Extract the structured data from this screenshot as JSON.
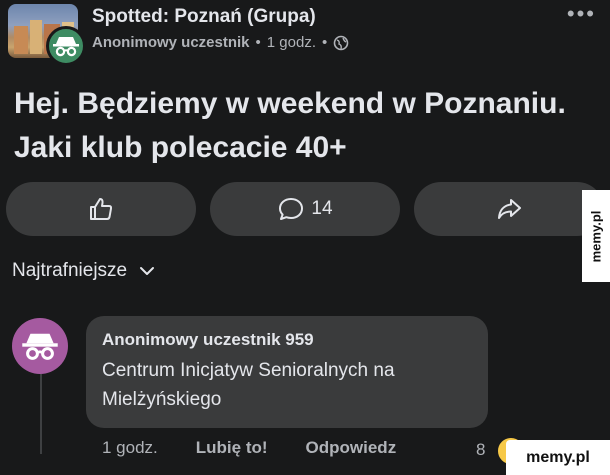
{
  "post": {
    "group_name": "Spotted: Poznań (Grupa)",
    "author": "Anonimowy uczestnik",
    "separator": "•",
    "time": "1 godz.",
    "separator2": "•",
    "text": "Hej. Będziemy w weekend w Poznaniu. Jaki klub polecacie 40+",
    "more_label": "•••"
  },
  "actions": {
    "like_icon": "thumbs-up-icon",
    "comment_icon": "comment-icon",
    "comment_count": "14",
    "share_icon": "share-icon"
  },
  "sort": {
    "label": "Najtrafniejsze"
  },
  "comment": {
    "author": "Anonimowy uczestnik 959",
    "text": "Centrum Inicjatyw Senioralnych na Mielżyńskiego",
    "time": "1 godz.",
    "like_label": "Lubię to!",
    "reply_label": "Odpowiedz",
    "reaction_count": "8"
  },
  "watermarks": {
    "side": "memy.pl",
    "corner": "memy.pl"
  },
  "colors": {
    "background": "#18191a",
    "button_bg": "#3a3b3c",
    "anon_avatar_green": "#3e8c63",
    "anon_avatar_purple": "#a55aa0"
  }
}
